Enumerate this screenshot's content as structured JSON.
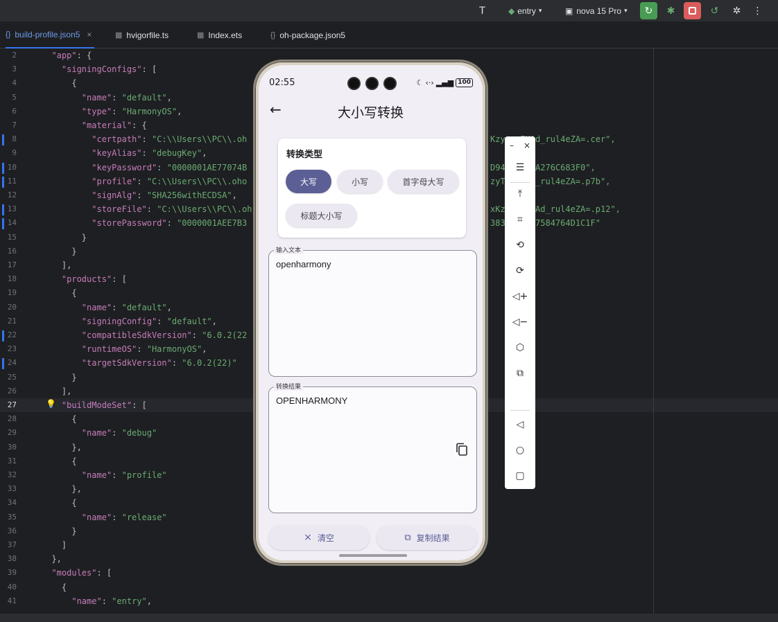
{
  "toolbar": {
    "module": "entry",
    "device": "nova 15 Pro",
    "colors": {
      "run": "#499c54",
      "stop": "#db5c5c"
    }
  },
  "tabs": [
    {
      "label": "build-profile.json5",
      "icon": "braces-icon"
    },
    {
      "label": "hvigorfile.ts",
      "icon": "file-grid-icon"
    },
    {
      "label": "Index.ets",
      "icon": "file-grid-icon"
    },
    {
      "label": "oh-package.json5",
      "icon": "braces-icon"
    }
  ],
  "editor": {
    "line_numbers": [
      "2",
      "3",
      "4",
      "5",
      "6",
      "7",
      "8",
      "9",
      "10",
      "11",
      "12",
      "13",
      "14",
      "15",
      "16",
      "17",
      "18",
      "19",
      "20",
      "21",
      "22",
      "23",
      "24",
      "25",
      "26",
      "27",
      "28",
      "29",
      "30",
      "31",
      "32",
      "33",
      "34",
      "35",
      "36",
      "37",
      "38",
      "39",
      "40",
      "41"
    ],
    "current_line": "27"
  },
  "phone": {
    "status_time": "02:55",
    "battery": "100",
    "title": "大小写转换",
    "type_card": {
      "title": "转换类型",
      "options": [
        "大写",
        "小写",
        "首字母大写",
        "标题大小写"
      ],
      "selected": "大写"
    },
    "input": {
      "label": "输入文本",
      "value": "openharmony"
    },
    "output": {
      "label": "转换结果",
      "value": "OPENHARMONY"
    },
    "buttons": {
      "clear": "清空",
      "copy": "复制结果"
    },
    "colors": {
      "primary": "#5c5e96",
      "chip_bg": "#ebe8f2",
      "screen_bg": "#f1eff5"
    }
  }
}
